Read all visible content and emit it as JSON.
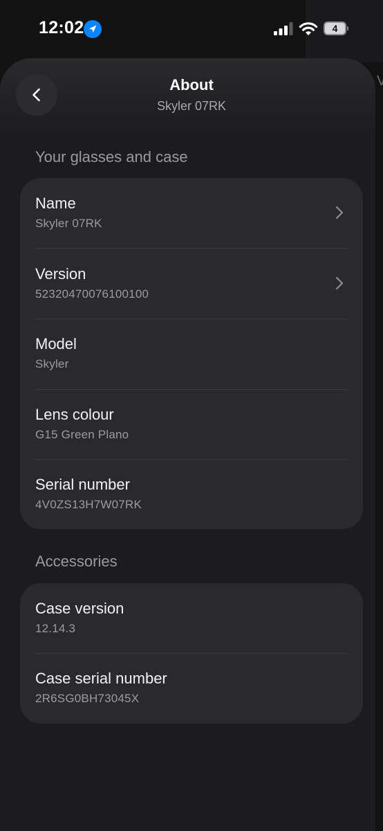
{
  "status_bar": {
    "time": "12:02",
    "battery": "4",
    "icons": [
      "location-arrow-icon",
      "cellular-signal-icon",
      "wifi-icon",
      "battery-icon"
    ]
  },
  "header": {
    "title": "About",
    "subtitle": "Skyler 07RK",
    "back_icon": "chevron-left-icon"
  },
  "edge_peek_letter": "V",
  "glasses_section": {
    "heading": "Your glasses and case",
    "rows": [
      {
        "title": "Name",
        "value": "Skyler 07RK",
        "chevron": true
      },
      {
        "title": "Version",
        "value": "52320470076100100",
        "chevron": true
      },
      {
        "title": "Model",
        "value": "Skyler",
        "chevron": false
      },
      {
        "title": "Lens colour",
        "value": "G15 Green Plano",
        "chevron": false
      },
      {
        "title": "Serial number",
        "value": "4V0ZS13H7W07RK",
        "chevron": false
      }
    ]
  },
  "accessories_section": {
    "heading": "Accessories",
    "rows": [
      {
        "title": "Case version",
        "value": "12.14.3",
        "chevron": false
      },
      {
        "title": "Case serial number",
        "value": "2R6SG0BH73045X",
        "chevron": false
      }
    ]
  },
  "colors": {
    "background": "#121213",
    "sheet": "#1c1c1e",
    "card": "#2a2a2d",
    "primary_text": "#f2f2f4",
    "secondary_text": "#9c9ca0",
    "location_accent": "#0a84ff"
  }
}
